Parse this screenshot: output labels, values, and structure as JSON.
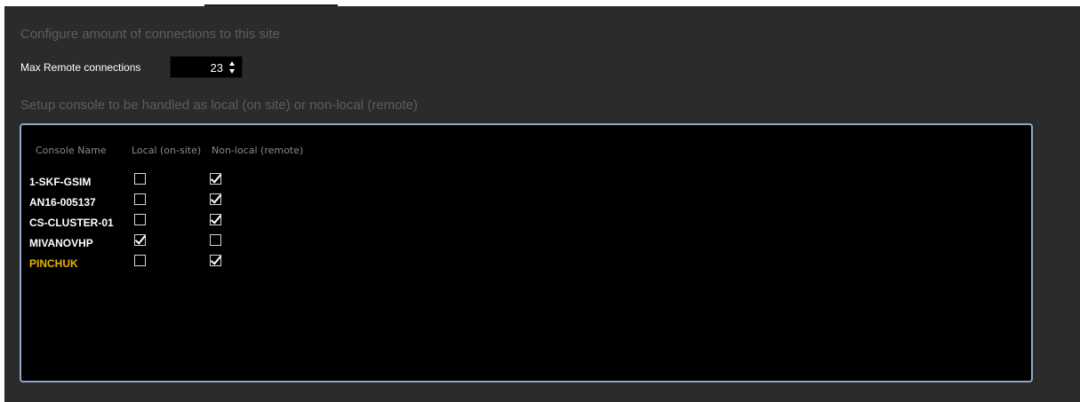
{
  "settings": {
    "heading_connections": "Configure amount of connections to this site",
    "max_remote_label": "Max Remote connections",
    "max_remote_value": "23",
    "heading_console": "Setup console to be handled as local (on site) or non-local (remote)"
  },
  "console_table": {
    "columns": [
      "Console Name",
      "Local (on-site)",
      "Non-local (remote)"
    ],
    "rows": [
      {
        "name": "1-SKF-GSIM",
        "local": false,
        "remote": true
      },
      {
        "name": "AN16-005137",
        "local": false,
        "remote": true
      },
      {
        "name": "CS-CLUSTER-01",
        "local": false,
        "remote": true
      },
      {
        "name": "MIVANOVHP",
        "local": true,
        "remote": false
      },
      {
        "name": "PINCHUK",
        "local": false,
        "remote": true
      }
    ]
  },
  "colors": {
    "panel_bg": "#2b2b2b",
    "box_border": "#8fa8c8",
    "highlight_name": "#e8b400",
    "heading_text": "#5d5d5d"
  },
  "icons": {
    "spinner": "up-down-arrows-icon",
    "checkbox": "checkbox-icon"
  }
}
